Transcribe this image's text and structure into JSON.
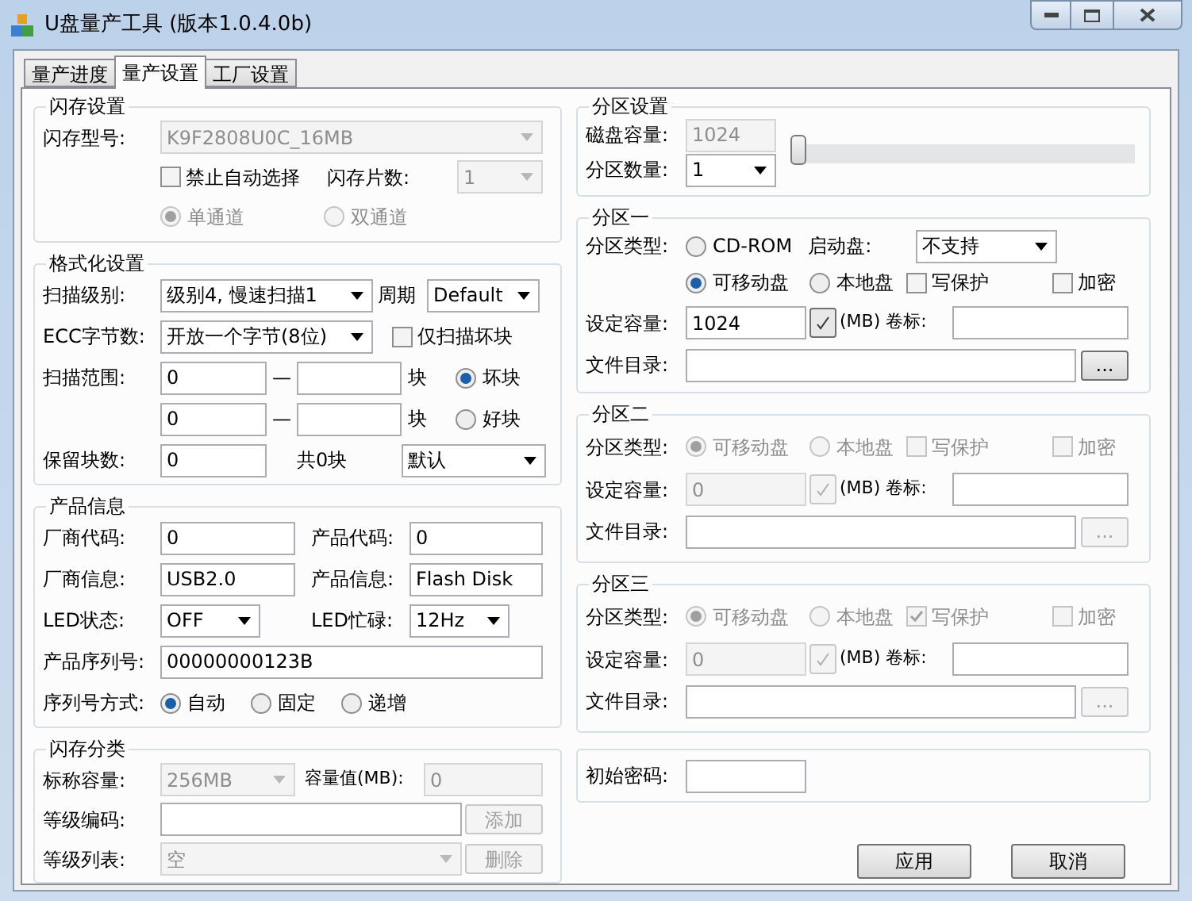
{
  "window": {
    "title": "U盘量产工具 (版本1.0.4.0b)"
  },
  "tabs": [
    {
      "label": "量产进度",
      "selected": false
    },
    {
      "label": "量产设置",
      "selected": true
    },
    {
      "label": "工厂设置",
      "selected": false
    }
  ],
  "flash_settings": {
    "title": "闪存设置",
    "model_label": "闪存型号:",
    "model": {
      "value": "K9F2808U0C_16MB",
      "disabled": true
    },
    "auto_select": {
      "label": "禁止自动选择",
      "checked": false
    },
    "chip_count_label": "闪存片数:",
    "chip_count": {
      "value": "1",
      "disabled": true
    },
    "channels": [
      {
        "label": "单通道",
        "selected": true,
        "disabled": true
      },
      {
        "label": "双通道",
        "selected": false,
        "disabled": true
      }
    ]
  },
  "format_settings": {
    "title": "格式化设置",
    "scan_level_label": "扫描级别:",
    "scan_level": "级别4, 慢速扫描1",
    "cycle_label": "周期",
    "cycle": "Default",
    "ecc_label": "ECC字节数:",
    "ecc": "开放一个字节(8位)",
    "bad_only": {
      "label": "仅扫描坏块",
      "checked": false
    },
    "range_label": "扫描范围:",
    "ranges": [
      {
        "from": "0",
        "separator": "—",
        "unit": "块",
        "option": {
          "label": "坏块",
          "selected": true
        }
      },
      {
        "from": "0",
        "separator": "—",
        "unit": "块",
        "option": {
          "label": "好块",
          "selected": false
        }
      }
    ],
    "reserved_label": "保留块数:",
    "reserved": "0",
    "total": "共0块",
    "mode": "默认"
  },
  "product_info": {
    "title": "产品信息",
    "vendor_code_label": "厂商代码:",
    "vendor_code": "0",
    "product_code_label": "产品代码:",
    "product_code": "0",
    "vendor_info_label": "厂商信息:",
    "vendor_info": "USB2.0",
    "product_info_label": "产品信息:",
    "product_info": "Flash Disk",
    "led_state_label": "LED状态:",
    "led_state": "OFF",
    "led_busy_label": "LED忙碌:",
    "led_busy": "12Hz",
    "serial_label": "产品序列号:",
    "serial": "00000000123B",
    "serial_mode_label": "序列号方式:",
    "serial_modes": [
      {
        "label": "自动",
        "selected": true
      },
      {
        "label": "固定",
        "selected": false
      },
      {
        "label": "递增",
        "selected": false
      }
    ]
  },
  "flash_class": {
    "title": "闪存分类",
    "nominal_label": "标称容量:",
    "nominal": {
      "value": "256MB",
      "disabled": true
    },
    "capacity_label": "容量值(MB):",
    "capacity": {
      "value": "0",
      "disabled": true
    },
    "grade_code_label": "等级编码:",
    "add_button": {
      "label": "添加",
      "disabled": true
    },
    "grade_list_label": "等级列表:",
    "grade_list": {
      "value": "空",
      "disabled": true
    },
    "delete_button": {
      "label": "删除",
      "disabled": true
    }
  },
  "partition_settings": {
    "title": "分区设置",
    "disk_capacity_label": "磁盘容量:",
    "disk_capacity": {
      "value": "1024",
      "disabled": true
    },
    "count_label": "分区数量:",
    "count": "1",
    "slider": {
      "level": 0
    }
  },
  "partitions": [
    {
      "title": "分区一",
      "disabled": false,
      "type_label": "分区类型:",
      "cdrom": {
        "label": "CD-ROM",
        "selected": false
      },
      "boot_label": "启动盘:",
      "boot": "不支持",
      "types": [
        {
          "label": "可移动盘",
          "selected": true
        },
        {
          "label": "本地盘",
          "selected": false
        }
      ],
      "write_protect": {
        "label": "写保护",
        "checked": false
      },
      "encrypt": {
        "label": "加密",
        "checked": false
      },
      "size_label": "设定容量:",
      "size": "1024",
      "unit_label": "(MB) 卷标:",
      "dir_label": "文件目录:",
      "browse": "..."
    },
    {
      "title": "分区二",
      "disabled": true,
      "type_label": "分区类型:",
      "types": [
        {
          "label": "可移动盘",
          "selected": true
        },
        {
          "label": "本地盘",
          "selected": false
        }
      ],
      "write_protect": {
        "label": "写保护",
        "checked": false
      },
      "encrypt": {
        "label": "加密",
        "checked": false
      },
      "size_label": "设定容量:",
      "size": "0",
      "unit_label": "(MB) 卷标:",
      "dir_label": "文件目录:",
      "browse": "..."
    },
    {
      "title": "分区三",
      "disabled": true,
      "type_label": "分区类型:",
      "types": [
        {
          "label": "可移动盘",
          "selected": true
        },
        {
          "label": "本地盘",
          "selected": false
        }
      ],
      "write_protect": {
        "label": "写保护",
        "checked": true
      },
      "encrypt": {
        "label": "加密",
        "checked": false
      },
      "size_label": "设定容量:",
      "size": "0",
      "unit_label": "(MB) 卷标:",
      "dir_label": "文件目录:",
      "browse": "..."
    }
  ],
  "password": {
    "label": "初始密码:"
  },
  "buttons": [
    {
      "label": "应用"
    },
    {
      "label": "取消"
    }
  ]
}
